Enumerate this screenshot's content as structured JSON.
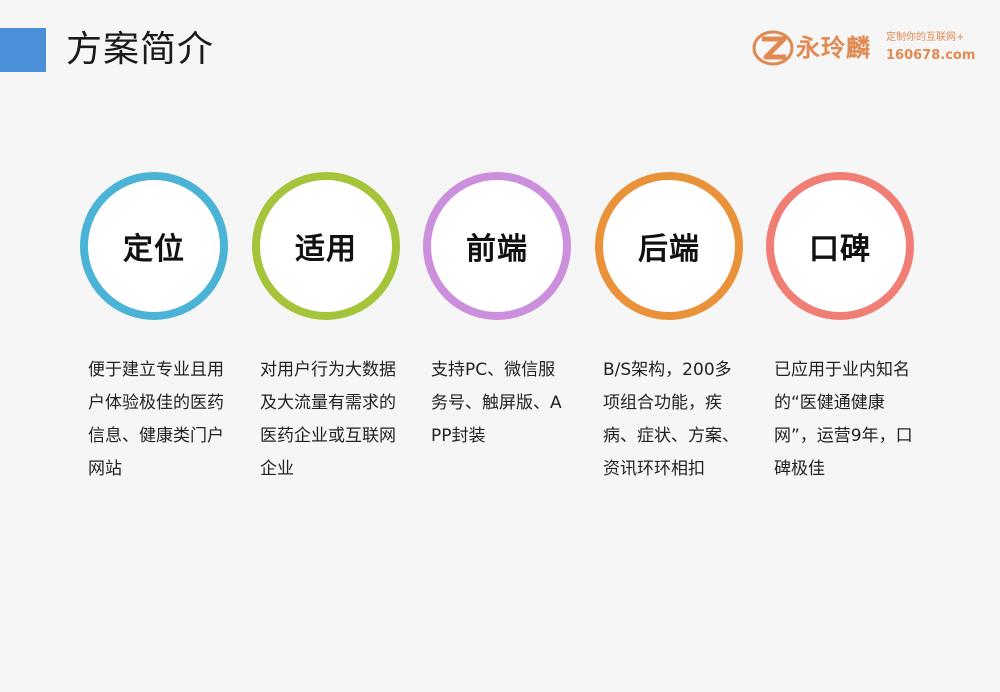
{
  "header": {
    "title": "方案简介",
    "accent_color": "#4a90d9"
  },
  "logo": {
    "name": "永玲麟",
    "slogan": "定制你的互联网+",
    "url": "160678.com",
    "color": "#e08a52",
    "icon": "brand-z-logo-icon"
  },
  "features": [
    {
      "label": "定位",
      "color": "#4ab3d6",
      "description": "便于建立专业且用户体验极佳的医药信息、健康类门户网站"
    },
    {
      "label": "适用",
      "color": "#a5c43a",
      "description": "对用户行为大数据及大流量有需求的医药企业或互联网企业"
    },
    {
      "label": "前端",
      "color": "#cc8fdc",
      "description": "支持PC、微信服务号、触屏版、APP封装"
    },
    {
      "label": "后端",
      "color": "#e9923a",
      "description": "B/S架构，200多项组合功能，疾病、症状、方案、资讯环环相扣"
    },
    {
      "label": "口碑",
      "color": "#f07e74",
      "description": "已应用于业内知名的“医健通健康网”，运营9年，口碑极佳"
    }
  ]
}
